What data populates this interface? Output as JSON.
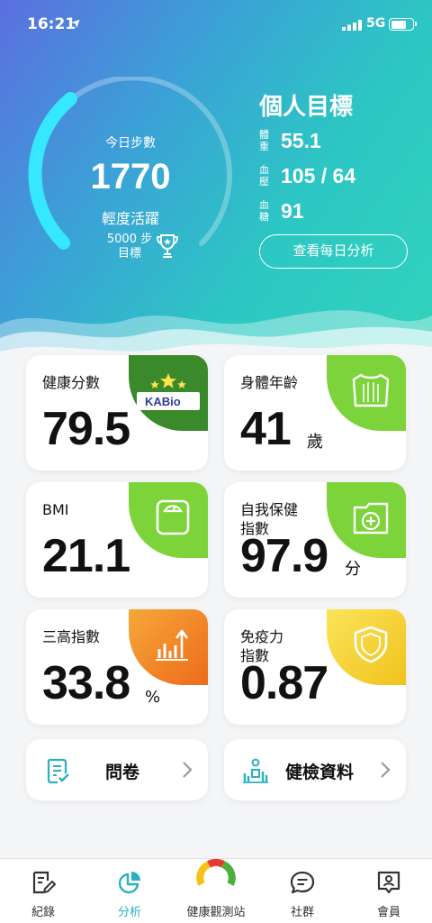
{
  "status_bar": {
    "time": "16:21",
    "location_arrow": "➤",
    "network": "5G"
  },
  "steps": {
    "label": "今日步數",
    "count": "1770",
    "level": "輕度活躍",
    "goal_line1": "5000 步",
    "goal_line2": "目標",
    "progress": 0.354
  },
  "personal_goals": {
    "title": "個人目標",
    "rows": [
      {
        "label": "體重",
        "value": "55.1"
      },
      {
        "label": "血壓",
        "value": "105 / 64"
      },
      {
        "label": "血糖",
        "value": "91"
      }
    ],
    "daily_button": "查看每日分析"
  },
  "cards": {
    "health_score": {
      "title": "健康分數",
      "value": "79.5",
      "logo_text": "KABio",
      "color": "#3a8a2c"
    },
    "body_age": {
      "title": "身體年齡",
      "value": "41",
      "unit": "歲",
      "color": "#7cd33a"
    },
    "bmi": {
      "title": "BMI",
      "value": "21.1",
      "color": "#7cd33a"
    },
    "self_care": {
      "title_line1": "自我保健",
      "title_line2": "指數",
      "value": "97.9",
      "unit": "分",
      "color": "#7cd33a"
    },
    "three_high": {
      "title": "三高指數",
      "value": "33.8",
      "unit": "%",
      "color": "#f28b1e"
    },
    "immunity": {
      "title_line1": "免疫力",
      "title_line2": "指數",
      "value": "0.87",
      "color": "#f5d12a"
    }
  },
  "links": {
    "questionnaire": "問卷",
    "checkup": "健檢資料"
  },
  "tabbar": {
    "record": "紀錄",
    "analysis": "分析",
    "station": "健康觀測站",
    "community": "社群",
    "member": "會員",
    "accent": "#2ab0c0"
  }
}
